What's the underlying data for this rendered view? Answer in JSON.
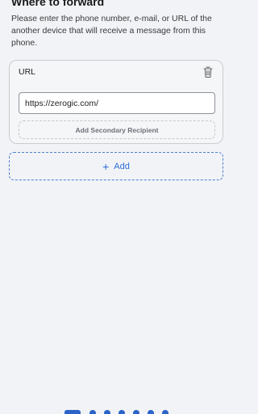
{
  "header": {
    "title": "Where to forward",
    "description": "Please enter the phone number, e-mail, or URL of the another device that will receive a message from this phone."
  },
  "recipient_card": {
    "type_label": "URL",
    "url_value": "https://zerogic.com/",
    "add_secondary_label": "Add Secondary Recipient"
  },
  "add_button": {
    "icon": "+",
    "label": "Add"
  },
  "pager": {
    "total_pages": 7,
    "current_page": 1
  },
  "colors": {
    "accent": "#2b63c8",
    "add_text": "#2d6fd6",
    "background": "#f1f3f6"
  }
}
